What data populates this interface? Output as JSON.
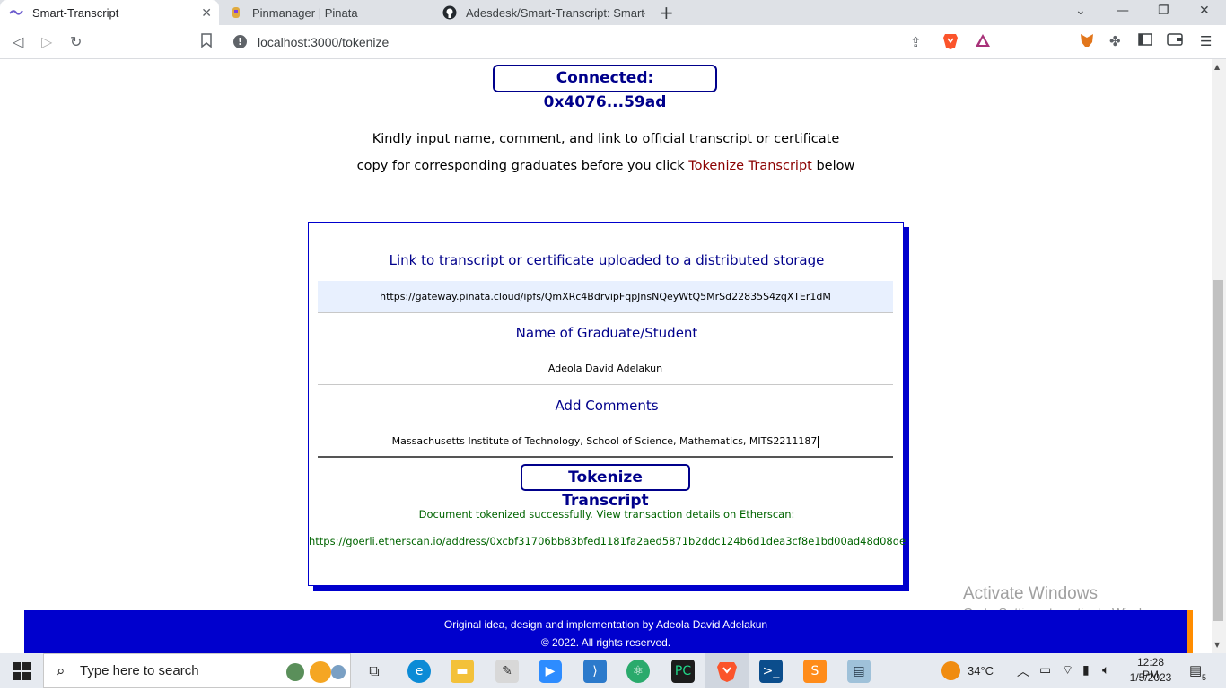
{
  "browser": {
    "tabs": [
      {
        "title": "Smart-Transcript",
        "active": true
      },
      {
        "title": "Pinmanager | Pinata",
        "active": false
      },
      {
        "title": "Adesdesk/Smart-Transcript: Smart-Tra",
        "active": false
      }
    ],
    "new_tab": "+",
    "url": "localhost:3000/tokenize"
  },
  "page": {
    "connected_label": "Connected: 0x4076...59ad",
    "instruction": {
      "line1": "Kindly input name, comment, and link to official transcript or certificate",
      "line2_pre": "copy for corresponding graduates before you click ",
      "line2_highlight": "Tokenize Transcript",
      "line2_post": " below"
    },
    "form": {
      "link_label": "Link to transcript or certificate uploaded to a distributed storage",
      "link_value": "https://gateway.pinata.cloud/ipfs/QmXRc4BdrvipFqpJnsNQeyWtQ5MrSd22835S4zqXTEr1dM",
      "name_label": "Name of Graduate/Student",
      "name_value": "Adeola David Adelakun",
      "comments_label": "Add Comments",
      "comments_value": "Massachusetts Institute of Technology, School of Science, Mathematics, MITS2211187"
    },
    "tokenize_button": "Tokenize Transcript",
    "success_message": "Document tokenized successfully. View transaction details on Etherscan:",
    "etherscan_link": "https://goerli.etherscan.io/address/0xcbf31706bb83bfed1181fa2aed5871b2ddc124b6d1dea3cf8e1bd00ad48d08de",
    "footer": {
      "line1": "Original idea, design and implementation by Adeola David Adelakun",
      "line2": "© 2022. All rights reserved."
    },
    "watermark": {
      "title": "Activate Windows",
      "subtitle": "Go to Settings to activate Windows."
    }
  },
  "taskbar": {
    "search_placeholder": "Type here to search",
    "weather": "34°C",
    "time": "12:28 PM",
    "date": "1/5/2023",
    "notifications": "5"
  },
  "colors": {
    "accent": "#0000cd",
    "dark_blue": "#00008b",
    "highlight": "#8b0000",
    "success": "#006400",
    "footer_shadow": "#ff8c00"
  }
}
